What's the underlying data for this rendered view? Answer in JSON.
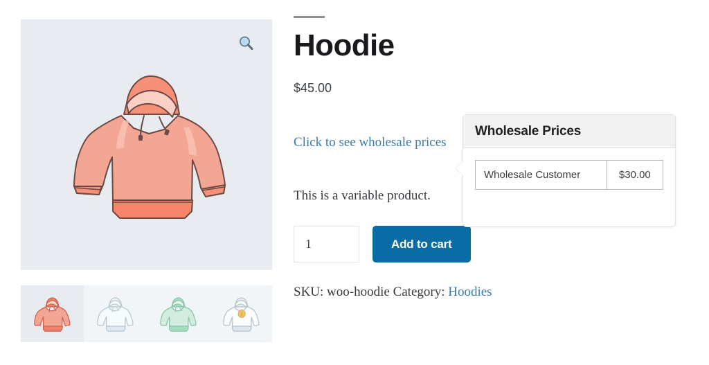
{
  "product": {
    "title": "Hoodie",
    "price": "$45.00",
    "short_description": "This is a variable product.",
    "wholesale_link_label": "Click to see wholesale prices",
    "sku_label": "SKU:",
    "sku_value": "woo-hoodie",
    "category_label": "Category:",
    "category_value": "Hoodies"
  },
  "gallery": {
    "zoom_icon": "magnifier-icon",
    "main_image_alt": "hoodie-salmon",
    "thumbnails": [
      {
        "alt": "hoodie-salmon",
        "selected": true
      },
      {
        "alt": "hoodie-blue",
        "selected": false
      },
      {
        "alt": "hoodie-green",
        "selected": false
      },
      {
        "alt": "hoodie-with-logo",
        "selected": false
      }
    ]
  },
  "cart": {
    "quantity_value": "1",
    "quantity_placeholder": "1",
    "add_to_cart_label": "Add to cart"
  },
  "wholesale_tooltip": {
    "heading": "Wholesale Prices",
    "columns": [
      "role",
      "price"
    ],
    "rows": [
      {
        "role": "Wholesale Customer",
        "price": "$30.00"
      }
    ]
  },
  "colors": {
    "accent_blue": "#0a6ca4",
    "link_blue": "#3a7ca8",
    "image_bg": "#e8ecf1",
    "thumb_bg": "#f2f5f8",
    "tooltip_header_bg": "#f2f2f2",
    "tooltip_border": "#e3e3e3",
    "hoodie_salmon": "#f0a393"
  }
}
